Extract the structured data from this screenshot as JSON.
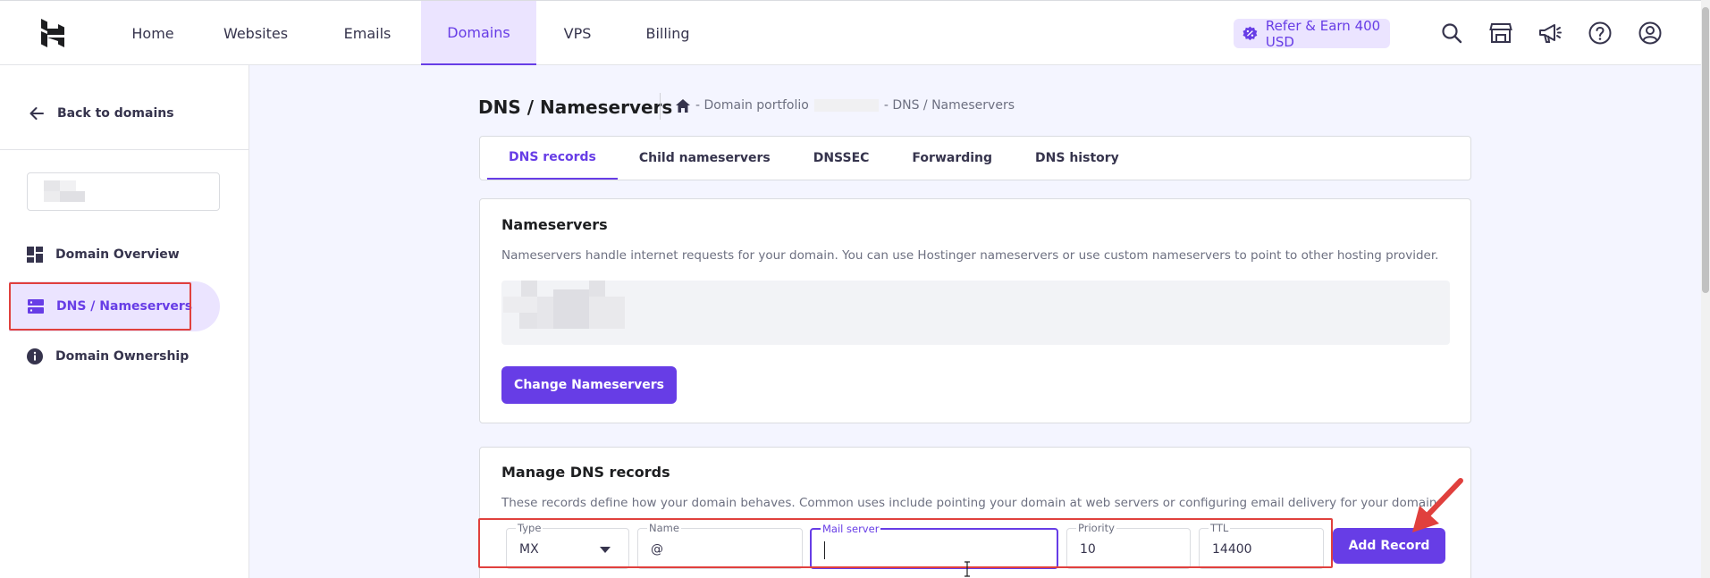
{
  "nav": {
    "items": [
      {
        "label": "Home",
        "active": false
      },
      {
        "label": "Websites",
        "active": false
      },
      {
        "label": "Emails",
        "active": false
      },
      {
        "label": "Domains",
        "active": true
      },
      {
        "label": "VPS",
        "active": false
      },
      {
        "label": "Billing",
        "active": false
      }
    ],
    "refer_label": "Refer & Earn 400 USD",
    "icons": [
      "search-icon",
      "store-icon",
      "megaphone-icon",
      "help-icon",
      "account-icon"
    ]
  },
  "sidebar": {
    "back_label": "Back to domains",
    "items": [
      {
        "label": "Domain Overview",
        "icon": "dashboard-icon",
        "active": false
      },
      {
        "label": "DNS / Nameservers",
        "icon": "server-icon",
        "active": true
      },
      {
        "label": "Domain Ownership",
        "icon": "info-icon",
        "active": false
      }
    ]
  },
  "page": {
    "title": "DNS / Nameservers",
    "breadcrumb": {
      "portfolio": "- Domain portfolio",
      "current": "- DNS / Nameservers"
    }
  },
  "tabs": [
    {
      "label": "DNS records",
      "active": true
    },
    {
      "label": "Child nameservers",
      "active": false
    },
    {
      "label": "DNSSEC",
      "active": false
    },
    {
      "label": "Forwarding",
      "active": false
    },
    {
      "label": "DNS history",
      "active": false
    }
  ],
  "nameservers_card": {
    "title": "Nameservers",
    "description": "Nameservers handle internet requests for your domain. You can use Hostinger nameservers or use custom nameservers to point to other hosting provider.",
    "button_label": "Change Nameservers"
  },
  "dns_card": {
    "title": "Manage DNS records",
    "description": "These records define how your domain behaves. Common uses include pointing your domain at web servers or configuring email delivery for your domain.",
    "form": {
      "type": {
        "label": "Type",
        "value": "MX"
      },
      "name": {
        "label": "Name",
        "value": "@"
      },
      "mail_server": {
        "label": "Mail server",
        "value": ""
      },
      "priority": {
        "label": "Priority",
        "value": "10"
      },
      "ttl": {
        "label": "TTL",
        "value": "14400"
      }
    },
    "add_button_label": "Add Record"
  },
  "colors": {
    "accent": "#673de6",
    "accent_light": "#ebe4ff",
    "annotation_red": "#e0403d"
  }
}
